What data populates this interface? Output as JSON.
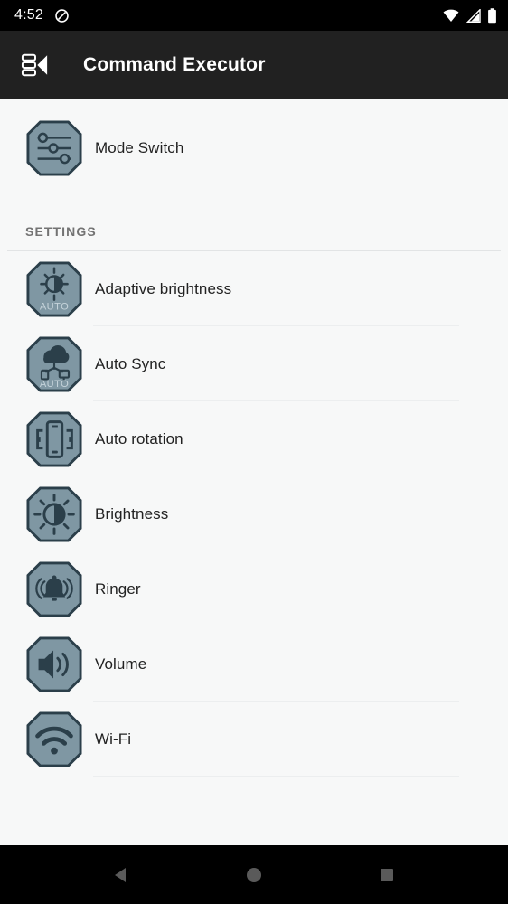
{
  "status_bar": {
    "time": "4:52",
    "dnd_icon": "do-not-disturb-icon",
    "wifi_icon": "wifi-icon",
    "signal_icon": "cellular-signal-icon",
    "battery_icon": "battery-full-icon",
    "background": "#000000",
    "foreground": "#ffffff"
  },
  "app_bar": {
    "title": "Command Executor",
    "drawer_icon": "drawer-back-icon",
    "background": "#212121",
    "title_color": "#ffffff"
  },
  "main": {
    "top_item": {
      "label": "Mode Switch",
      "icon": "sliders-icon"
    },
    "section": {
      "header": "SETTINGS",
      "items": [
        {
          "label": "Adaptive brightness",
          "icon": "auto-brightness-icon",
          "badge": "AUTO"
        },
        {
          "label": "Auto Sync",
          "icon": "auto-sync-icon",
          "badge": "AUTO"
        },
        {
          "label": "Auto rotation",
          "icon": "auto-rotate-icon",
          "badge": ""
        },
        {
          "label": "Brightness",
          "icon": "brightness-icon",
          "badge": ""
        },
        {
          "label": "Ringer",
          "icon": "ringer-bell-icon",
          "badge": ""
        },
        {
          "label": "Volume",
          "icon": "volume-speaker-icon",
          "badge": ""
        },
        {
          "label": "Wi-Fi",
          "icon": "wifi-icon",
          "badge": ""
        }
      ]
    }
  },
  "nav_bar": {
    "back_icon": "back-triangle-icon",
    "home_icon": "home-circle-icon",
    "recents_icon": "recents-square-icon",
    "background": "#000000",
    "icon_color": "#5a5a5a"
  },
  "theme": {
    "page_background": "#f7f8f8",
    "icon_fill": "#7f97a3",
    "icon_stroke": "#2b3f4a",
    "divider": "#eceeef",
    "section_label_color": "#737373",
    "item_label_color": "#222222"
  }
}
